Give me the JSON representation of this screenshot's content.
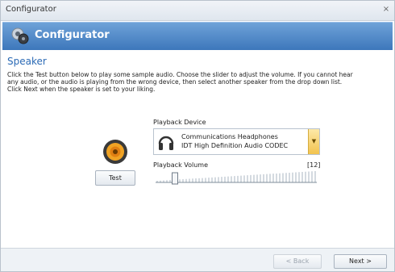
{
  "window": {
    "title": "Configurator",
    "close_glyph": "×"
  },
  "banner": {
    "title": "Configurator",
    "icon": "configurator-gear-icon"
  },
  "page": {
    "section_title": "Speaker",
    "instructions": "Click the Test button below to play some sample audio. Choose the slider to adjust the volume. If you cannot hear\nany audio, or the audio is playing from the wrong device, then select another speaker from the drop down list.\nClick Next when the speaker is set to your liking."
  },
  "test_button": {
    "label": "Test"
  },
  "playback_device": {
    "label": "Playback Device",
    "selected_name": "Communications Headphones",
    "selected_driver": "IDT High Definition Audio CODEC",
    "icon": "headphones-icon"
  },
  "playback_volume": {
    "label": "Playback Volume",
    "value_text": "[12]",
    "level_fraction": 0.12
  },
  "nav": {
    "back_label": "< Back",
    "next_label": "Next >"
  },
  "colors": {
    "accent": "#2b6ab5",
    "banner": "#4f86c6",
    "dropdown": "#f2c34e"
  }
}
